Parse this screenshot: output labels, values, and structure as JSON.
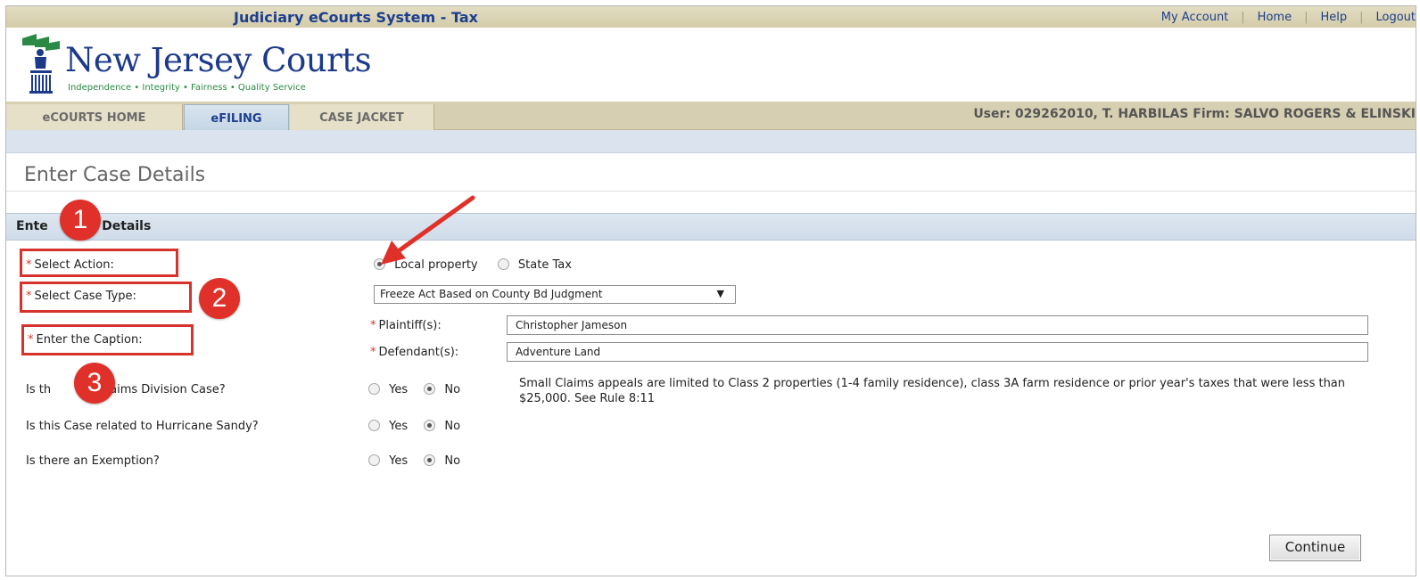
{
  "header": {
    "system_title": "Judiciary eCourts System - Tax",
    "links": [
      "My Account",
      "Home",
      "Help",
      "Logout"
    ],
    "separator": "|",
    "logo_name": "New Jersey Courts",
    "logo_tagline": "Independence • Integrity • Fairness • Quality Service",
    "logo_icon": "statue-icon"
  },
  "nav": {
    "tabs": [
      "eCOURTS HOME",
      "eFILING",
      "CASE JACKET"
    ],
    "active_tab": "eFILING",
    "user_info": "User: 029262010, T. HARBILAS  Firm: SALVO ROGERS & ELINSKI"
  },
  "page": {
    "title": "Enter Case Details",
    "section_title_left": "Ente",
    "section_title_right": "e Details"
  },
  "form": {
    "required_marker": "*",
    "select_action_label": "Select Action:",
    "action_options": [
      "Local property",
      "State Tax"
    ],
    "action_selected": "Local property",
    "case_type_label": "Select Case Type:",
    "case_type_value": "Freeze Act  Based on County Bd Judgment",
    "case_type_caret": "▼",
    "caption_label": "Enter the Caption:",
    "plaintiff_label": "Plaintiff(s):",
    "plaintiff_value": "Christopher Jameson",
    "defendant_label": "Defendant(s):",
    "defendant_value": "Adventure Land",
    "q_small_claims_left": "Is th",
    "q_small_claims_right": "ll Claims Division Case?",
    "q_hurricane": "Is this Case related to Hurricane Sandy?",
    "q_exemption": "Is there an Exemption?",
    "yes_label": "Yes",
    "no_label": "No",
    "answers": {
      "small_claims": "No",
      "hurricane": "No",
      "exemption": "No"
    },
    "small_claims_note": "Small Claims appeals are limited to Class 2 properties (1-4 family residence), class 3A farm residence or prior year's taxes that were less than $25,000. See Rule 8:11",
    "continue_label": "Continue"
  },
  "annotations": {
    "callouts": [
      "1",
      "2",
      "3"
    ],
    "highlight_color": "#d7322c",
    "arrow_color": "#e0302a"
  },
  "colors": {
    "brand_blue": "#1c3f8f",
    "tab_bar": "#d6cfb2",
    "section_blue": "#dbe4ee",
    "required_red": "#d9372b"
  }
}
